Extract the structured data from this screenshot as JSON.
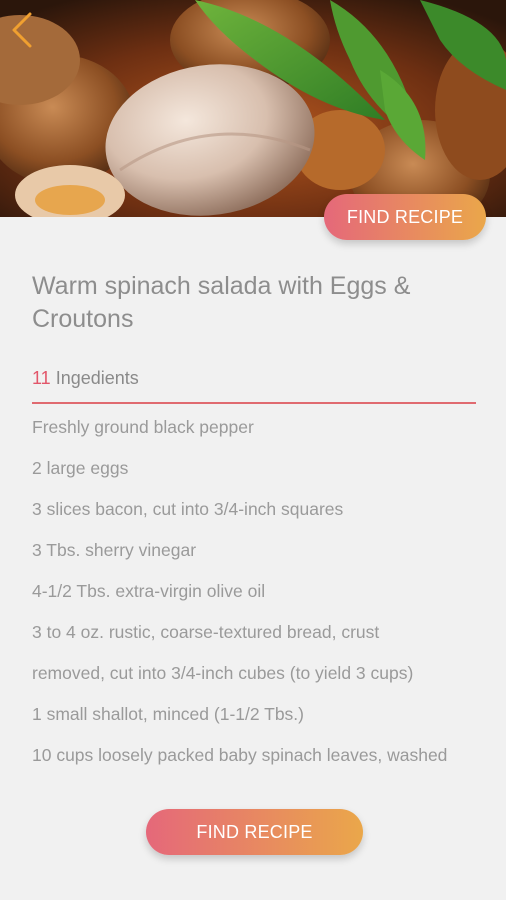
{
  "header": {
    "back_icon": "chevron-left-icon",
    "find_recipe_label": "FIND RECIPE",
    "accent_gradient": [
      "#e5687a",
      "#eaa74a"
    ]
  },
  "recipe": {
    "title": "Warm spinach salada with Eggs & Croutons",
    "ingredients_count": "11",
    "ingredients_label": "Ingedients",
    "ingredients": [
      "Freshly ground black pepper",
      "2 large eggs",
      "3 slices bacon, cut into 3/4-inch squares",
      "3 Tbs. sherry vinegar",
      "4-1/2 Tbs. extra-virgin olive oil",
      "3 to 4 oz. rustic, coarse-textured bread, crust",
      "removed, cut into 3/4-inch cubes (to yield 3 cups)",
      "1 small shallot, minced (1-1/2 Tbs.)",
      "10 cups loosely packed baby spinach leaves, washed"
    ]
  },
  "footer": {
    "find_recipe_label": "FIND RECIPE"
  },
  "colors": {
    "background": "#f1f1f1",
    "count_accent": "#e2566a",
    "divider": "#e06a70",
    "back_chevron": "#f0a030"
  }
}
